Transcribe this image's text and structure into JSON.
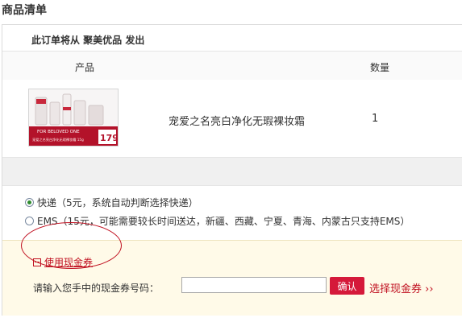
{
  "page": {
    "section_title": "商品清单"
  },
  "order": {
    "ship_from": "此订单将从 聚美优品 发出",
    "columns": {
      "product": "产品",
      "quantity": "数量"
    },
    "items": [
      {
        "name": "宠爱之名亮白净化无瑕裸妆霜",
        "quantity": "1",
        "thumb": {
          "banner_text": "FOR BELOVED ONE",
          "caption": "宠爱之名亮白净化无瑕裸妆霜 15g",
          "price": "179"
        }
      }
    ]
  },
  "shipping": {
    "options": [
      {
        "label": "快递（5元，系统自动判断选择快递）",
        "checked": true
      },
      {
        "label": "EMS（15元，可能需要较长时间送达，新疆、西藏、宁夏、青海、内蒙古只支持EMS）",
        "checked": false
      }
    ]
  },
  "coupon": {
    "toggle_label": "使用现金券",
    "input_label": "请输入您手中的现金券号码：",
    "input_value": "",
    "confirm_label": "确认",
    "select_link": "选择现金券 ››"
  },
  "colors": {
    "accent_red": "#c01020",
    "button_red": "#d5193a",
    "coupon_bg": "#fffae8",
    "radio_green": "#2e8b2e"
  }
}
